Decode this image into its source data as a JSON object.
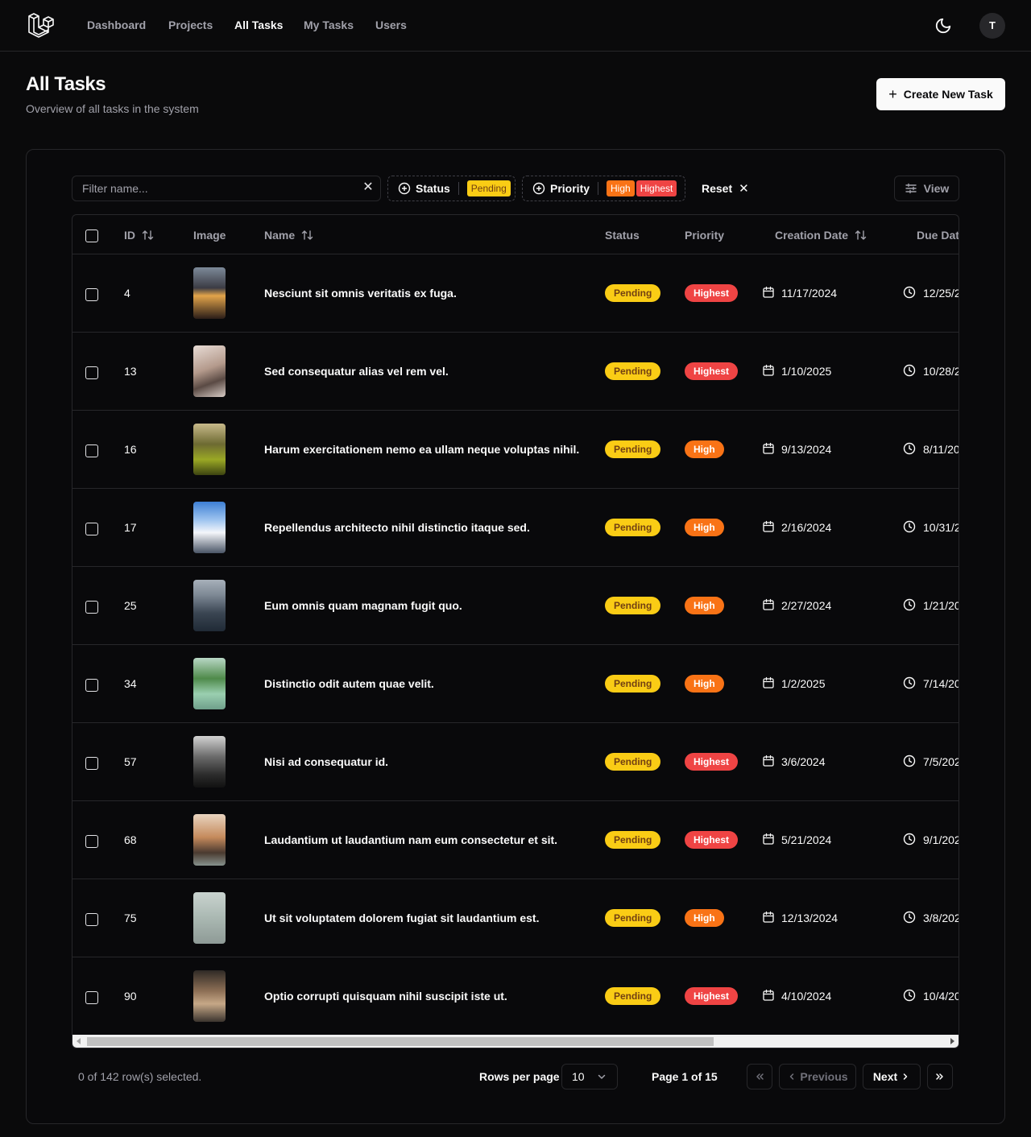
{
  "nav": {
    "items": [
      {
        "label": "Dashboard",
        "active": false
      },
      {
        "label": "Projects",
        "active": false
      },
      {
        "label": "All Tasks",
        "active": true
      },
      {
        "label": "My Tasks",
        "active": false
      },
      {
        "label": "Users",
        "active": false
      }
    ],
    "avatar_initial": "T",
    "theme_icon": "moon-icon"
  },
  "header": {
    "title": "All Tasks",
    "subtitle": "Overview of all tasks in the system",
    "create_button": "Create New Task"
  },
  "toolbar": {
    "filter_placeholder": "Filter name...",
    "status_filter": {
      "label": "Status",
      "selected": [
        "Pending"
      ]
    },
    "priority_filter": {
      "label": "Priority",
      "selected": [
        "High",
        "Highest"
      ]
    },
    "reset_label": "Reset",
    "view_label": "View"
  },
  "table": {
    "columns": [
      "ID",
      "Image",
      "Name",
      "Status",
      "Priority",
      "Creation Date",
      "Due Dat"
    ],
    "rows": [
      {
        "id": "4",
        "name": "Nesciunt sit omnis veritatis ex fuga.",
        "status": "Pending",
        "priority": "Highest",
        "created": "11/17/2024",
        "due": "12/25/2"
      },
      {
        "id": "13",
        "name": "Sed consequatur alias vel rem vel.",
        "status": "Pending",
        "priority": "Highest",
        "created": "1/10/2025",
        "due": "10/28/2"
      },
      {
        "id": "16",
        "name": "Harum exercitationem nemo ea ullam neque voluptas nihil.",
        "status": "Pending",
        "priority": "High",
        "created": "9/13/2024",
        "due": "8/11/20"
      },
      {
        "id": "17",
        "name": "Repellendus architecto nihil distinctio itaque sed.",
        "status": "Pending",
        "priority": "High",
        "created": "2/16/2024",
        "due": "10/31/2"
      },
      {
        "id": "25",
        "name": "Eum omnis quam magnam fugit quo.",
        "status": "Pending",
        "priority": "High",
        "created": "2/27/2024",
        "due": "1/21/20"
      },
      {
        "id": "34",
        "name": "Distinctio odit autem quae velit.",
        "status": "Pending",
        "priority": "High",
        "created": "1/2/2025",
        "due": "7/14/20"
      },
      {
        "id": "57",
        "name": "Nisi ad consequatur id.",
        "status": "Pending",
        "priority": "Highest",
        "created": "3/6/2024",
        "due": "7/5/202"
      },
      {
        "id": "68",
        "name": "Laudantium ut laudantium nam eum consectetur et sit.",
        "status": "Pending",
        "priority": "Highest",
        "created": "5/21/2024",
        "due": "9/1/202"
      },
      {
        "id": "75",
        "name": "Ut sit voluptatem dolorem fugiat sit laudantium est.",
        "status": "Pending",
        "priority": "High",
        "created": "12/13/2024",
        "due": "3/8/202"
      },
      {
        "id": "90",
        "name": "Optio corrupti quisquam nihil suscipit iste ut.",
        "status": "Pending",
        "priority": "Highest",
        "created": "4/10/2024",
        "due": "10/4/20"
      }
    ]
  },
  "footer": {
    "selected_text": "0 of 142 row(s) selected.",
    "rows_per_page_label": "Rows per page",
    "rows_per_page_value": "10",
    "page_info": "Page 1 of 15",
    "previous_label": "Previous",
    "next_label": "Next"
  },
  "colors": {
    "pending": "#facc15",
    "high": "#f97316",
    "highest": "#ef4444",
    "background": "#0a0a0b",
    "border": "#27272a"
  }
}
